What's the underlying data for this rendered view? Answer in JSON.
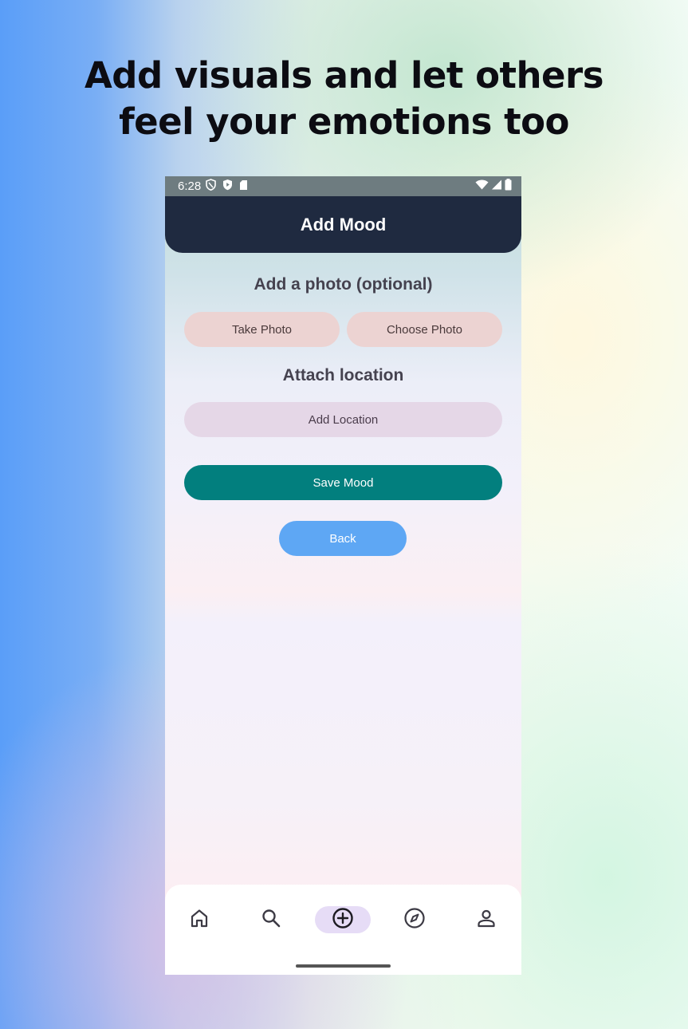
{
  "headline": {
    "line1": "Add visuals and let others",
    "line2": "feel your emotions too"
  },
  "status_bar": {
    "time": "6:28",
    "left_icons": [
      "shield-outline-icon",
      "shield-play-icon",
      "sd-card-icon"
    ],
    "right_icons": [
      "wifi-icon",
      "cell-signal-icon",
      "battery-icon"
    ]
  },
  "app_bar": {
    "title": "Add Mood"
  },
  "photo_section": {
    "title": "Add a photo (optional)",
    "take_photo_label": "Take Photo",
    "choose_photo_label": "Choose Photo"
  },
  "location_section": {
    "title": "Attach location",
    "add_location_label": "Add Location"
  },
  "actions": {
    "save_label": "Save Mood",
    "back_label": "Back"
  },
  "bottom_nav": {
    "items": [
      {
        "icon": "home-icon",
        "active": false
      },
      {
        "icon": "search-icon",
        "active": false
      },
      {
        "icon": "add-circle-icon",
        "active": true
      },
      {
        "icon": "compass-icon",
        "active": false
      },
      {
        "icon": "profile-icon",
        "active": false
      }
    ]
  },
  "colors": {
    "app_bar": "#1f2a40",
    "status_bar": "#6e7c80",
    "save_button": "#027f7e",
    "back_button": "#5ea7f4",
    "photo_buttons": "#ecd3d2",
    "location_button": "#e5d7e7",
    "active_nav_pill": "#e6dcf6"
  }
}
